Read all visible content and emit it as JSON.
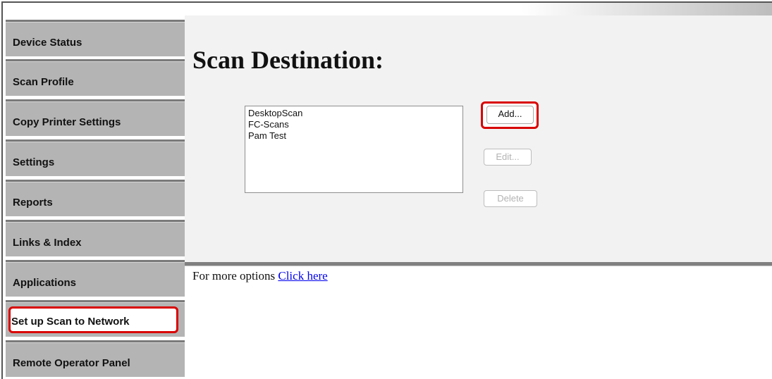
{
  "sidebar": {
    "items": [
      {
        "label": "Device Status"
      },
      {
        "label": "Scan Profile"
      },
      {
        "label": "Copy Printer Settings"
      },
      {
        "label": "Settings"
      },
      {
        "label": "Reports"
      },
      {
        "label": "Links & Index"
      },
      {
        "label": "Applications"
      },
      {
        "label": "Set up Scan to Network",
        "active": true
      },
      {
        "label": "Remote Operator Panel"
      }
    ]
  },
  "main": {
    "title": "Scan Destination:",
    "destinations": [
      "DesktopScan",
      "FC-Scans",
      "Pam Test"
    ],
    "buttons": {
      "add": "Add...",
      "edit": "Edit...",
      "delete": "Delete"
    }
  },
  "footer": {
    "text": "For more options",
    "link": "Click here"
  },
  "colors": {
    "highlight": "#d90000",
    "sidebar_bg": "#b4b4b4",
    "content_bg": "#f2f2f2",
    "link": "#0000ee"
  }
}
